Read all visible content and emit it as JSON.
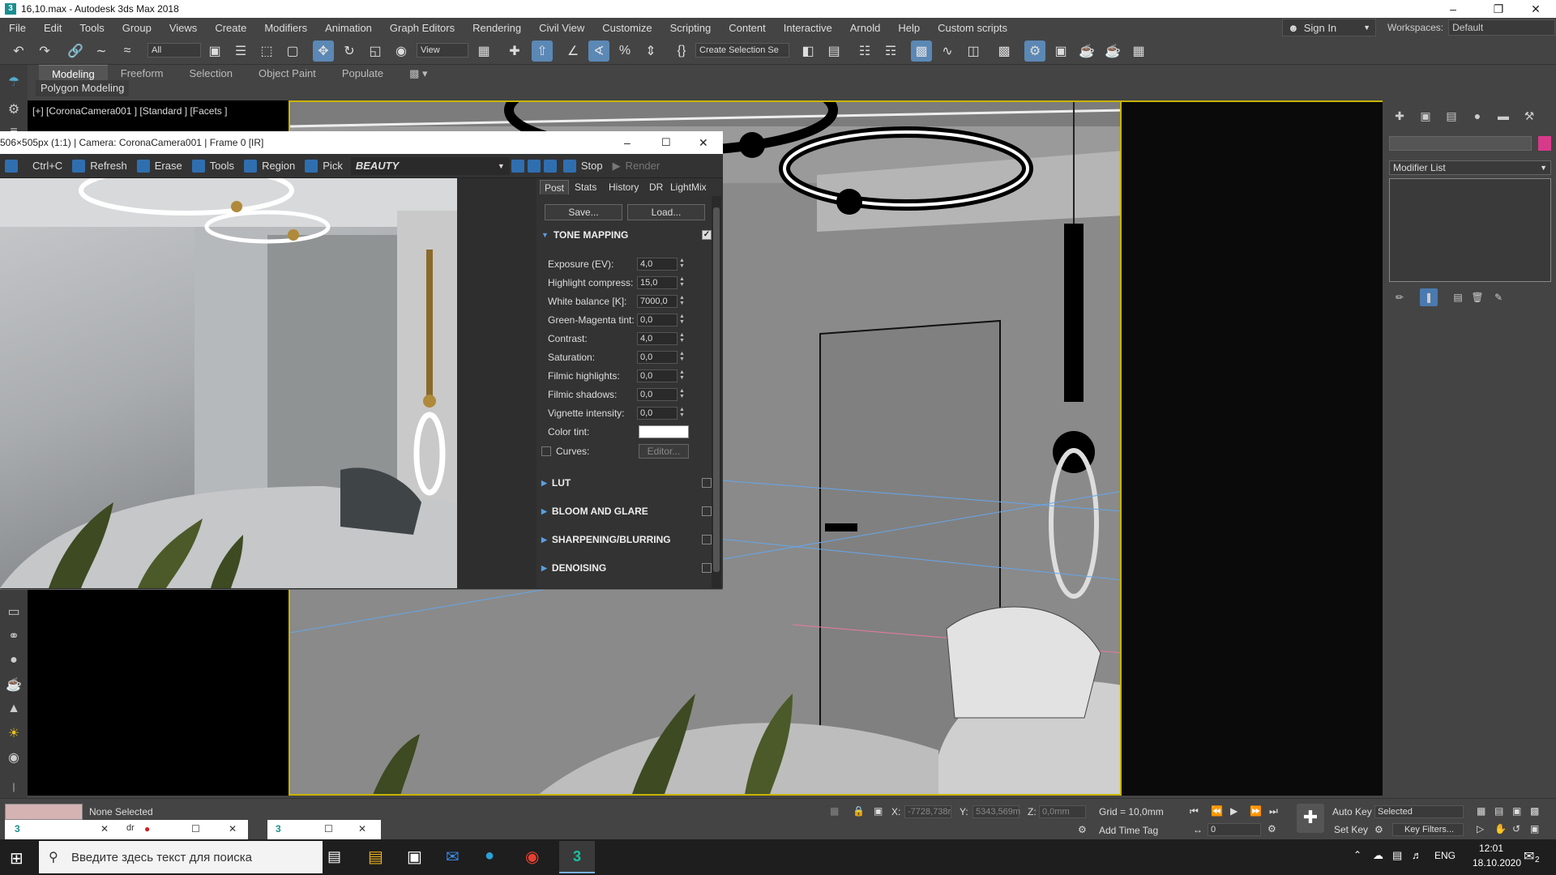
{
  "window": {
    "title": "16,10.max - Autodesk 3ds Max 2018",
    "app_icon": "3ds-max-icon"
  },
  "menu": [
    "File",
    "Edit",
    "Tools",
    "Group",
    "Views",
    "Create",
    "Modifiers",
    "Animation",
    "Graph Editors",
    "Rendering",
    "Civil View",
    "Customize",
    "Scripting",
    "Content",
    "Interactive",
    "Arnold",
    "Help",
    "Custom scripts"
  ],
  "signin": {
    "label": "Sign In"
  },
  "workspaces": {
    "label": "Workspaces:",
    "value": "Default"
  },
  "toolbar": {
    "filter_value": "All",
    "refcoord_value": "View",
    "selection_set_placeholder": "Create Selection Se"
  },
  "ribbon": {
    "tabs": [
      "Modeling",
      "Freeform",
      "Selection",
      "Object Paint",
      "Populate"
    ],
    "active_tab": "Modeling",
    "sub_label": "Polygon Modeling"
  },
  "viewport": {
    "label": "[+] [CoronaCamera001 ] [Standard ] [Facets ]"
  },
  "command_panel": {
    "modifier_list": "Modifier List",
    "color_swatch": "#d83a8a"
  },
  "vfb": {
    "title": "506×505px (1:1) | Camera: CoronaCamera001 | Frame 0 [IR]",
    "toolbar": {
      "copy": "Ctrl+C",
      "refresh": "Refresh",
      "erase": "Erase",
      "tools": "Tools",
      "region": "Region",
      "pick": "Pick",
      "channel": "BEAUTY",
      "stop": "Stop",
      "render": "Render"
    },
    "tabs": [
      "Post",
      "Stats",
      "History",
      "DR",
      "LightMix"
    ],
    "active_tab": "Post",
    "save_label": "Save...",
    "load_label": "Load...",
    "tone_mapping": {
      "title": "TONE MAPPING",
      "enabled": true,
      "params": [
        {
          "label": "Exposure (EV):",
          "value": "4,0"
        },
        {
          "label": "Highlight compress:",
          "value": "15,0"
        },
        {
          "label": "White balance [K]:",
          "value": "7000,0"
        },
        {
          "label": "Green-Magenta tint:",
          "value": "0,0"
        },
        {
          "label": "Contrast:",
          "value": "4,0"
        },
        {
          "label": "Saturation:",
          "value": "0,0"
        },
        {
          "label": "Filmic highlights:",
          "value": "0,0"
        },
        {
          "label": "Filmic shadows:",
          "value": "0,0"
        },
        {
          "label": "Vignette intensity:",
          "value": "0,0"
        }
      ],
      "color_tint_label": "Color tint:",
      "color_tint_value": "#ffffff",
      "curves_label": "Curves:",
      "curves_editor": "Editor..."
    },
    "sections": [
      "LUT",
      "BLOOM AND GLARE",
      "SHARPENING/BLURRING",
      "DENOISING"
    ]
  },
  "status": {
    "selection": "None Selected",
    "x_label": "X:",
    "x_value": "-7728,738r",
    "y_label": "Y:",
    "y_value": "5343,569m",
    "z_label": "Z:",
    "z_value": "0,0mm",
    "grid": "Grid = 10,0mm",
    "add_time_tag": "Add Time Tag",
    "auto_key": "Auto Key",
    "set_key": "Set Key",
    "key_mode": "Selected",
    "key_filters": "Key Filters...",
    "frame_value": "0"
  },
  "taskbar": {
    "search_placeholder": "Введите здесь текст для поиска",
    "lang": "ENG",
    "time": "12:01",
    "date": "18.10.2020",
    "notif_count": "2",
    "mini_label": "dr"
  }
}
